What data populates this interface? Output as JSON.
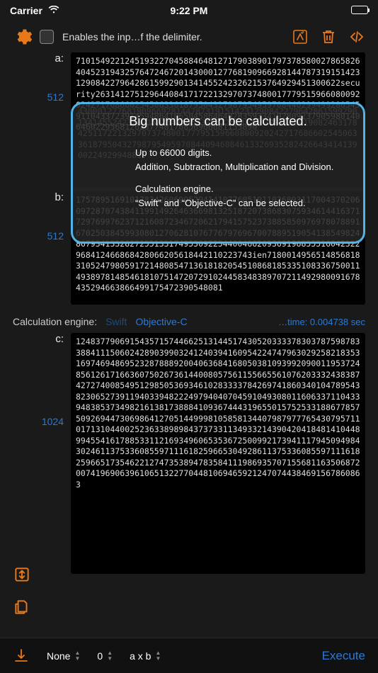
{
  "status": {
    "carrier": "Carrier",
    "time": "9:22 PM"
  },
  "topbar": {
    "checkbox_label": "Enables the inp…f the delimiter."
  },
  "a": {
    "label": "a:",
    "digits": "512",
    "value": "71015492212451932270458846481271790389017973785800278658264045231943257647246720143000127768190966928144787319151423129084227964286159929013414552423262153764929451300622security263141275129644084171722132970737480017779515966080092024271768660254506336187950432798795495970844629949928054591104337239145948641065045864640283593341928092379059801406460229568126237748170856966681153890"
  },
  "b": {
    "label": "b:",
    "digits": "512",
    "value": "17578951691017834260699529414107760519110268931170043702060972870743841199149264636698132518720738683075934614416371729769976237121608723467206217941575237388585097697807889167025038459930801270628107677679769670078895190541385498248679341332827255133174953092254400466209369196855516042322968412466868428066205618442110223743ien718001495651485681831052479805917214808547136181820545108681853351083367500114938978148546181075147207291024458348389707211492980091678435294663866499175472390548081"
  },
  "c": {
    "label": "c:",
    "digits": "1024",
    "value": "12483779069154357157446625131445174305203333783037875987833884111506024289039903241240394160954224747963029258218353169746948695232878889200406368416805038109399209001195372485612617166360750267361440080575611556655610762033324383874272740085495129850536934610283333784269741860340104789543823065273911940339482224979404070459104930801160633711043394838537349821613817388841093674443196550157525331886778575092694473069864127051449998105858134407987977765430795711017131044002523633898984373733113493321439042041848141044899455416178853311216934960653536725009921739411179450949843024611375336085597111618259665304928611375336085597111618259665173546221274735389478358411198693570715568116350687200741969063961065132277044810694659212470744384691567860863"
  },
  "callout": {
    "title": "Big numbers can be calculated.",
    "line1": "Up to 66000 digits.",
    "line2": "Addition, Subtraction, Multiplication and Division.",
    "line3": "Calculation engine.",
    "line4": "“Swift” and “Objective-C” can be selected.",
    "bg": "43000127768190966928144787319151423129084227964286159929013414552423262153764846513006225233240378126601908246317842511722132970737480017779515966080092024271768660254506336187950432798795495970844094608461332693528242664341413900224929948810"
  },
  "engine": {
    "label": "Calculation engine:",
    "opt1": "Swift",
    "opt2": "Objective-C",
    "time_label": "…time:",
    "time_value": "0.004738 sec"
  },
  "bottom": {
    "sel1": "None",
    "sel2": "0",
    "sel3": "a x b",
    "execute": "Execute"
  }
}
